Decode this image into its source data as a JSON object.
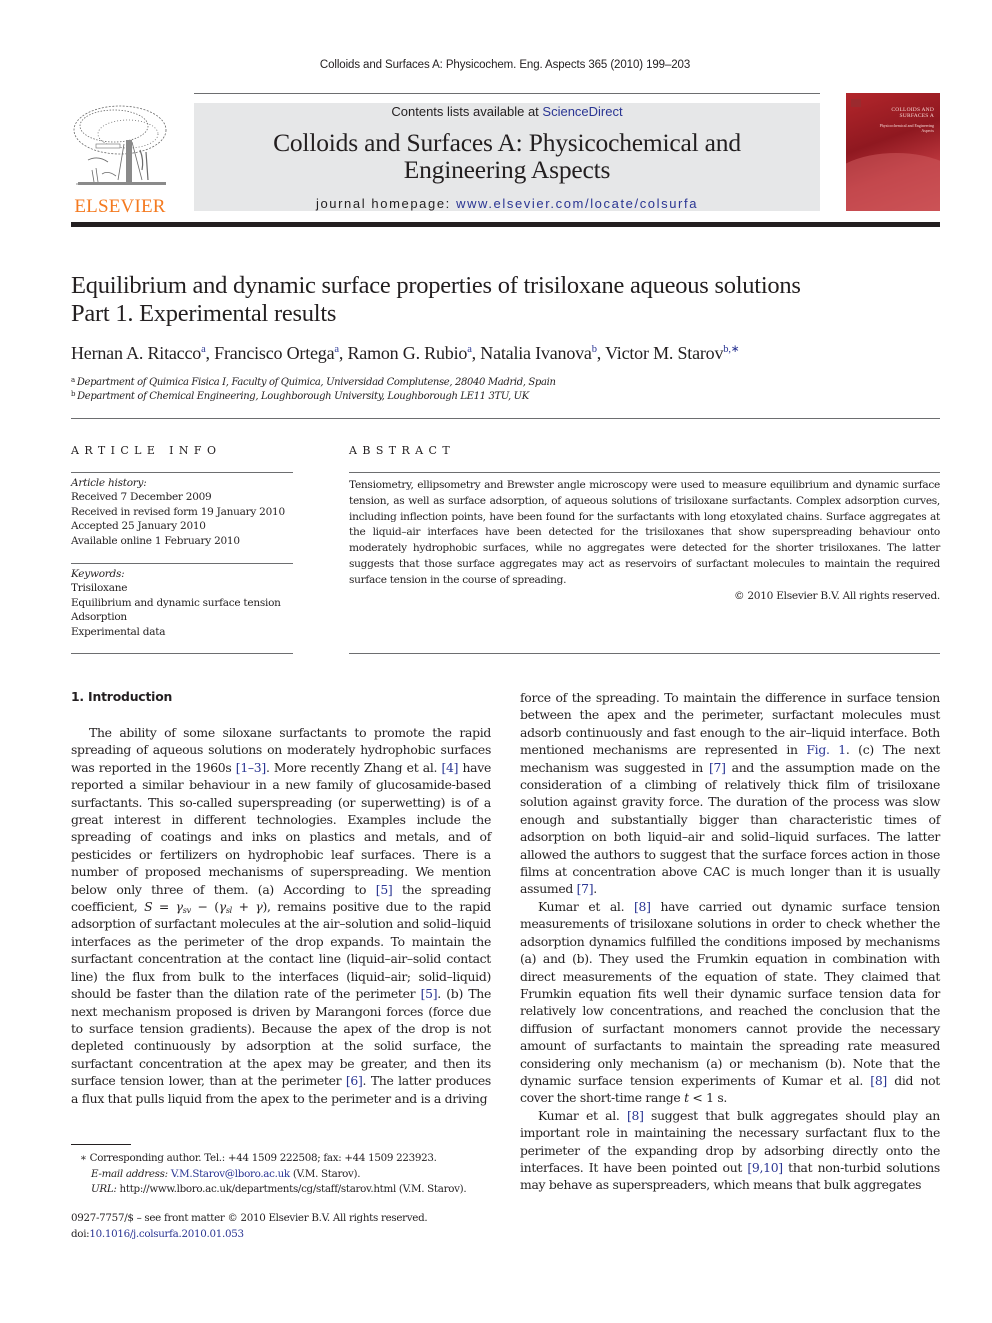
{
  "running_head": "Colloids and Surfaces A: Physicochem. Eng. Aspects 365 (2010) 199–203",
  "header": {
    "publisher_logo_text": "ELSEVIER",
    "contents_prefix": "Contents lists available at ",
    "contents_link": "ScienceDirect",
    "journal_title_line1": "Colloids and Surfaces A: Physicochemical and",
    "journal_title_line2": "Engineering Aspects",
    "homepage_prefix": "journal homepage: ",
    "homepage_link": "www.elsevier.com/locate/colsurfa",
    "cover_title": "COLLOIDS AND SURFACES A",
    "cover_subtitle": "Physicochemical and Engineering Aspects",
    "colors": {
      "publisher_orange": "#f47a20",
      "link_blue": "#2a3593",
      "banner_gray": "#e6e7e8",
      "cover_red": "#b3262b"
    }
  },
  "article": {
    "title_line1": "Equilibrium and dynamic surface properties of trisiloxane aqueous solutions",
    "title_line2": "Part 1. Experimental results",
    "authors": [
      {
        "name": "Hernan A. Ritacco",
        "sup": "a",
        "sep": ", "
      },
      {
        "name": "Francisco Ortega",
        "sup": "a",
        "sep": ", "
      },
      {
        "name": "Ramon G. Rubio",
        "sup": "a",
        "sep": ", "
      },
      {
        "name": "Natalia Ivanova",
        "sup": "b",
        "sep": ", "
      },
      {
        "name": "Victor M. Starov",
        "sup": "b,∗",
        "sep": ""
      }
    ],
    "affiliations": [
      {
        "mark": "a",
        "text": "Department of Quimica Fisica I, Faculty of Quimica, Universidad Complutense, 28040 Madrid, Spain"
      },
      {
        "mark": "b",
        "text": "Department of Chemical Engineering, Loughborough University, Loughborough LE11 3TU, UK"
      }
    ]
  },
  "article_info": {
    "heading": "ARTICLE INFO",
    "history_label": "Article history:",
    "history": [
      "Received 7 December 2009",
      "Received in revised form 19 January 2010",
      "Accepted 25 January 2010",
      "Available online 1 February 2010"
    ],
    "keywords_label": "Keywords:",
    "keywords": [
      "Trisiloxane",
      "Equilibrium and dynamic surface tension",
      "Adsorption",
      "Experimental data"
    ]
  },
  "abstract": {
    "heading": "ABSTRACT",
    "text": "Tensiometry, ellipsometry and Brewster angle microscopy were used to measure equilibrium and dynamic surface tension, as well as surface adsorption, of aqueous solutions of trisiloxane surfactants. Complex adsorption curves, including inflection points, have been found for the surfactants with long etoxylated chains. Surface aggregates at the liquid–air interfaces have been detected for the trisiloxanes that show superspreading behaviour onto moderately hydrophobic surfaces, while no aggregates were detected for the shorter trisiloxanes. The latter suggests that those surface aggregates may act as reservoirs of surfactant molecules to maintain the required surface tension in the course of spreading.",
    "copyright": "© 2010 Elsevier B.V. All rights reserved."
  },
  "body": {
    "section_heading": "1.  Introduction",
    "left": {
      "p1_a": "The ability of some siloxane surfactants to promote the rapid spreading of aqueous solutions on moderately hydrophobic surfaces was reported in the 1960s ",
      "p1_ref1": "[1–3]",
      "p1_b": ". More recently Zhang et al. ",
      "p1_ref2": "[4]",
      "p1_c": " have reported a similar behaviour in a new family of glucosamide-based surfactants. This so-called superspreading (or superwetting) is of a great interest in different technologies. Examples include the spreading of coatings and inks on plastics and metals, and of pesticides or fertilizers on hydrophobic leaf surfaces. There is a number of proposed mechanisms of superspreading. We mention below only three of them. (a) According to ",
      "p1_ref3": "[5]",
      "p1_d": " the spreading coefficient, ",
      "eq_S": "S",
      "eq_eq": " = ",
      "eq_g1": "γ",
      "eq_sv": "sv",
      "eq_mid": " − (",
      "eq_g2": "γ",
      "eq_sl": "sl",
      "eq_plus": " + ",
      "eq_g3": "γ",
      "eq_close": ")",
      "p1_e": ", remains positive due to the rapid adsorption of surfactant molecules at the air–solution and solid–liquid interfaces as the perimeter of the drop expands. To maintain the surfactant concentration at the contact line (liquid–air–solid contact line) the flux from bulk to the interfaces (liquid–air; solid–liquid) should be faster than the dilation rate of the perimeter ",
      "p1_ref4": "[5]",
      "p1_f": ". (b) The next mechanism proposed is driven by Marangoni forces (force due to surface tension gradients). Because the apex of the drop is not depleted continuously by adsorption at the solid surface, the surfactant concentration at the apex may be greater, and then its surface tension lower, than at the perimeter ",
      "p1_ref5": "[6]",
      "p1_g": ". The latter produces a flux that pulls liquid from the apex to the perimeter and is a driving"
    },
    "right": {
      "p1_a": "force of the spreading. To maintain the difference in surface tension between the apex and the perimeter, surfactant molecules must adsorb continuously and fast enough to the air–liquid interface. Both mentioned mechanisms are represented in ",
      "p1_fig": "Fig. 1",
      "p1_b": ". (c) The next mechanism was suggested in ",
      "p1_ref1": "[7]",
      "p1_c": " and the assumption made on the consideration of a climbing of relatively thick film of trisiloxane solution against gravity force. The duration of the process was slow enough and substantially bigger than characteristic times of adsorption on both liquid–air and solid–liquid surfaces. The latter allowed the authors to suggest that the surface forces action in those films at concentration above CAC is much longer than it is usually assumed ",
      "p1_ref2": "[7]",
      "p1_d": ".",
      "p2_a": "Kumar et al. ",
      "p2_ref1": "[8]",
      "p2_b": " have carried out dynamic surface tension measurements of trisiloxane solutions in order to check whether the adsorption dynamics fulfilled the conditions imposed by mechanisms (a) and (b). They used the Frumkin equation in combination with direct measurements of the equation of state. They claimed that Frumkin equation fits well their dynamic surface tension data for relatively low concentrations, and reached the conclusion that the diffusion of surfactant monomers cannot provide the necessary amount of surfactants to maintain the spreading rate measured considering only mechanism (a) or mechanism (b). Note that the dynamic surface tension experiments of Kumar et al. ",
      "p2_ref2": "[8]",
      "p2_c": " did not cover the short-time range ",
      "p2_t": "t",
      "p2_d": " < 1 s.",
      "p3_a": "Kumar et al. ",
      "p3_ref1": "[8]",
      "p3_b": " suggest that bulk aggregates should play an important role in maintaining the necessary surfactant flux to the perimeter of the expanding drop by adsorbing directly onto the interfaces. It have been pointed out ",
      "p3_ref2": "[9,10]",
      "p3_c": " that non-turbid solutions may behave as superspreaders, which means that bulk aggregates"
    }
  },
  "footnotes": {
    "star": "∗",
    "corresponding": " Corresponding author. Tel.: +44 1509 222508; fax: +44 1509 223923.",
    "email_label": "E-mail address:",
    "email": "V.M.Starov@lboro.ac.uk",
    "email_suffix": " (V.M. Starov).",
    "url_label": "URL:",
    "url": " http://www.lboro.ac.uk/departments/cg/staff/starov.html (V.M. Starov).",
    "issn_line": "0927-7757/$ – see front matter © 2010 Elsevier B.V. All rights reserved.",
    "doi_prefix": "doi:",
    "doi": "10.1016/j.colsurfa.2010.01.053"
  }
}
